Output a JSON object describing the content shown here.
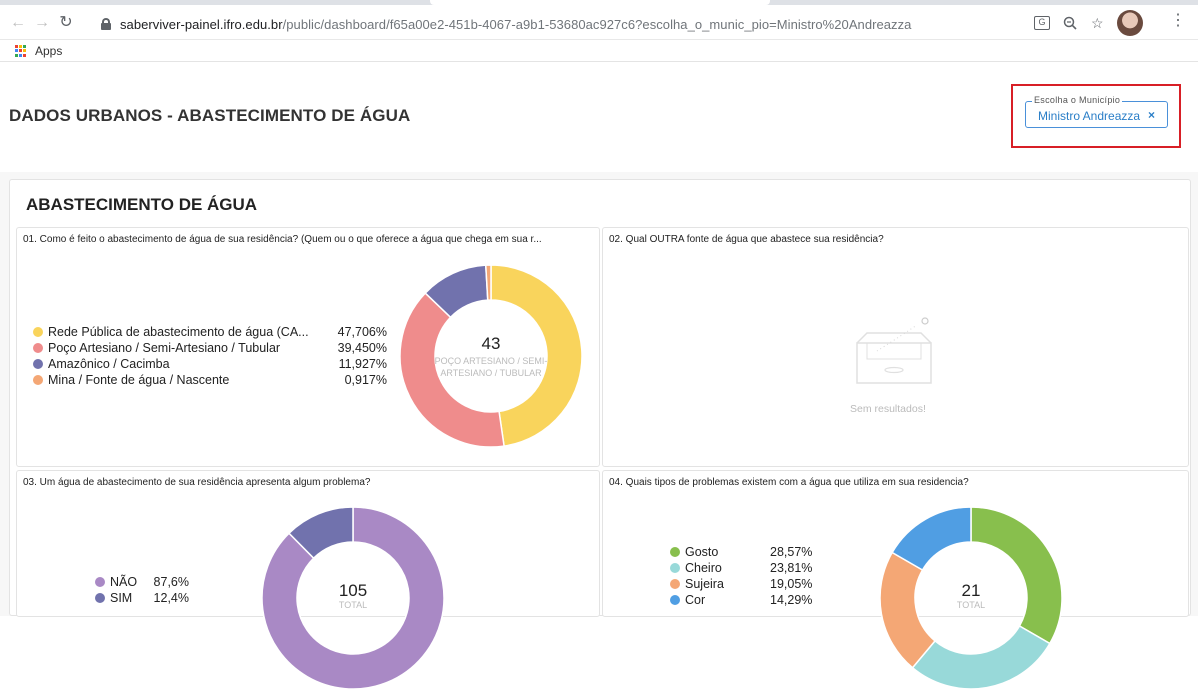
{
  "browser": {
    "url_host": "saberviver-painel.ifro.edu.br",
    "url_path": "/public/dashboard/f65a00e2-451b-4067-a9b1-53680ac927c6?escolha_o_munic_pio=Ministro%20Andreazza",
    "bookmarks_apps_label": "Apps",
    "icons": [
      "back-icon",
      "forward-icon",
      "reload-icon",
      "lock-icon",
      "translate-icon",
      "zoom-icon",
      "star-icon",
      "profile-avatar",
      "menu-icon",
      "apps-icon"
    ]
  },
  "dashboard": {
    "title": "DADOS URBANOS - ABASTECIMENTO DE ÁGUA",
    "filter": {
      "label": "Escolha o Município",
      "value": "Ministro Andreazza",
      "clear": "×"
    },
    "section_title": "ABASTECIMENTO DE ÁGUA",
    "highlight_color": "#d81f26"
  },
  "cards": [
    {
      "title": "01. Como é feito o abastecimento de água de sua residência? (Quem ou o que oferece a água que chega em sua r...",
      "center_value": "43",
      "center_label": "POÇO ARTESIANO / SEMI-ARTESIANO / TUBULAR",
      "center_label_line1": "POÇO ARTESIANO / SEMI-",
      "center_label_line2": "ARTESIANO / TUBULAR",
      "legend": [
        {
          "label": "Rede Pública de abastecimento de água (CA...",
          "pct": "47,706%",
          "color": "#f9d45c"
        },
        {
          "label": "Poço Artesiano / Semi-Artesiano / Tubular",
          "pct": "39,450%",
          "color": "#ef8c8c"
        },
        {
          "label": "Amazônico / Cacimba",
          "pct": "11,927%",
          "color": "#7172ad"
        },
        {
          "label": "Mina / Fonte de água / Nascente",
          "pct": "0,917%",
          "color": "#f4a775"
        }
      ]
    },
    {
      "title": "02. Qual OUTRA fonte de água que abastece sua residência?",
      "empty_text": "Sem resultados!"
    },
    {
      "title": "03. Um água de abastecimento de sua residência apresenta algum problema?",
      "center_value": "105",
      "center_label": "TOTAL",
      "legend": [
        {
          "label": "NÃO",
          "pct": "87,6%",
          "color": "#a989c5"
        },
        {
          "label": "SIM",
          "pct": "12,4%",
          "color": "#7172ad"
        }
      ]
    },
    {
      "title": "04. Quais tipos de problemas existem com a água que utiliza em sua residencia?",
      "center_value": "21",
      "center_label": "TOTAL",
      "legend": [
        {
          "label": "Gosto",
          "pct": "28,57%",
          "color": "#88bf4d"
        },
        {
          "label": "Cheiro",
          "pct": "23,81%",
          "color": "#98d9d9"
        },
        {
          "label": "Sujeira",
          "pct": "19,05%",
          "color": "#f4a775"
        },
        {
          "label": "Cor",
          "pct": "14,29%",
          "color": "#509ee3"
        }
      ]
    }
  ],
  "chart_data": [
    {
      "type": "pie",
      "title": "01. Como é feito o abastecimento de água de sua residência? (Quem ou o que oferece a água que chega em sua r...",
      "categories": [
        "Rede Pública de abastecimento de água (CA...",
        "Poço Artesiano / Semi-Artesiano / Tubular",
        "Amazônico / Cacimba",
        "Mina / Fonte de água / Nascente"
      ],
      "values": [
        47.706,
        39.45,
        11.927,
        0.917
      ],
      "colors": [
        "#f9d45c",
        "#ef8c8c",
        "#7172ad",
        "#f4a775"
      ],
      "center": "43",
      "legend_position": "left"
    },
    {
      "type": "pie",
      "title": "03. Um água de abastecimento de sua residência apresenta algum problema?",
      "categories": [
        "NÃO",
        "SIM"
      ],
      "values": [
        87.6,
        12.4
      ],
      "colors": [
        "#a989c5",
        "#7172ad"
      ],
      "center": "105",
      "legend_position": "left"
    },
    {
      "type": "pie",
      "title": "04. Quais tipos de problemas existem com a água que utiliza em sua residencia?",
      "categories": [
        "Gosto",
        "Cheiro",
        "Sujeira",
        "Cor"
      ],
      "values": [
        28.57,
        23.81,
        19.05,
        14.29
      ],
      "colors": [
        "#88bf4d",
        "#98d9d9",
        "#f4a775",
        "#509ee3"
      ],
      "center": "21",
      "legend_position": "left"
    }
  ]
}
